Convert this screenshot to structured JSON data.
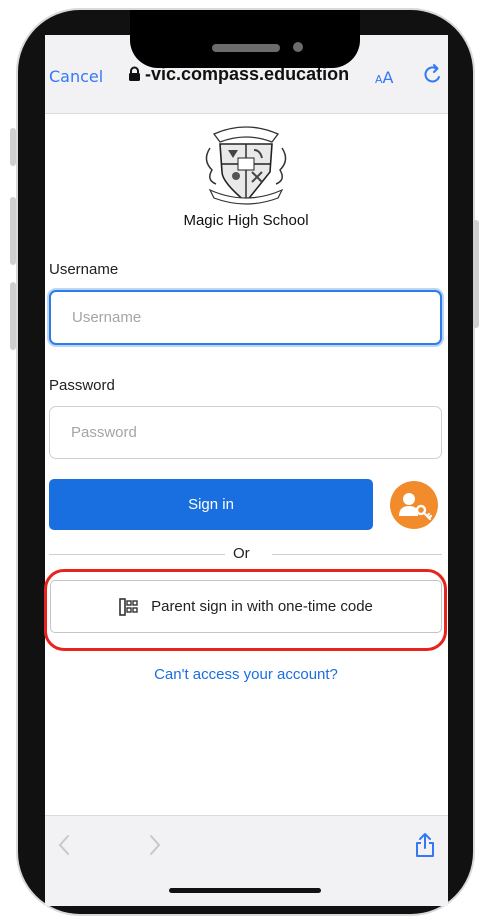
{
  "browser": {
    "cancel_label": "Cancel",
    "url": "-vic.compass.education",
    "text_size_label": "AA"
  },
  "page": {
    "school_name": "Magic High School",
    "username_label": "Username",
    "username_placeholder": "Username",
    "password_label": "Password",
    "password_placeholder": "Password",
    "signin_label": "Sign in",
    "or_label": "Or",
    "parent_signin_label": "Parent sign in with one-time code",
    "cant_access_label": "Can't access your account?"
  },
  "icons": {
    "lock": "lock-icon",
    "reload": "reload-icon",
    "key": "key-icon",
    "keypad": "keypad-icon",
    "back": "back-arrow-icon",
    "forward": "forward-arrow-icon",
    "share": "share-icon"
  },
  "colors": {
    "accent": "#1a6fe0",
    "ios_blue": "#3478f6",
    "key_button": "#f28b2c",
    "highlight": "#e8231e"
  }
}
